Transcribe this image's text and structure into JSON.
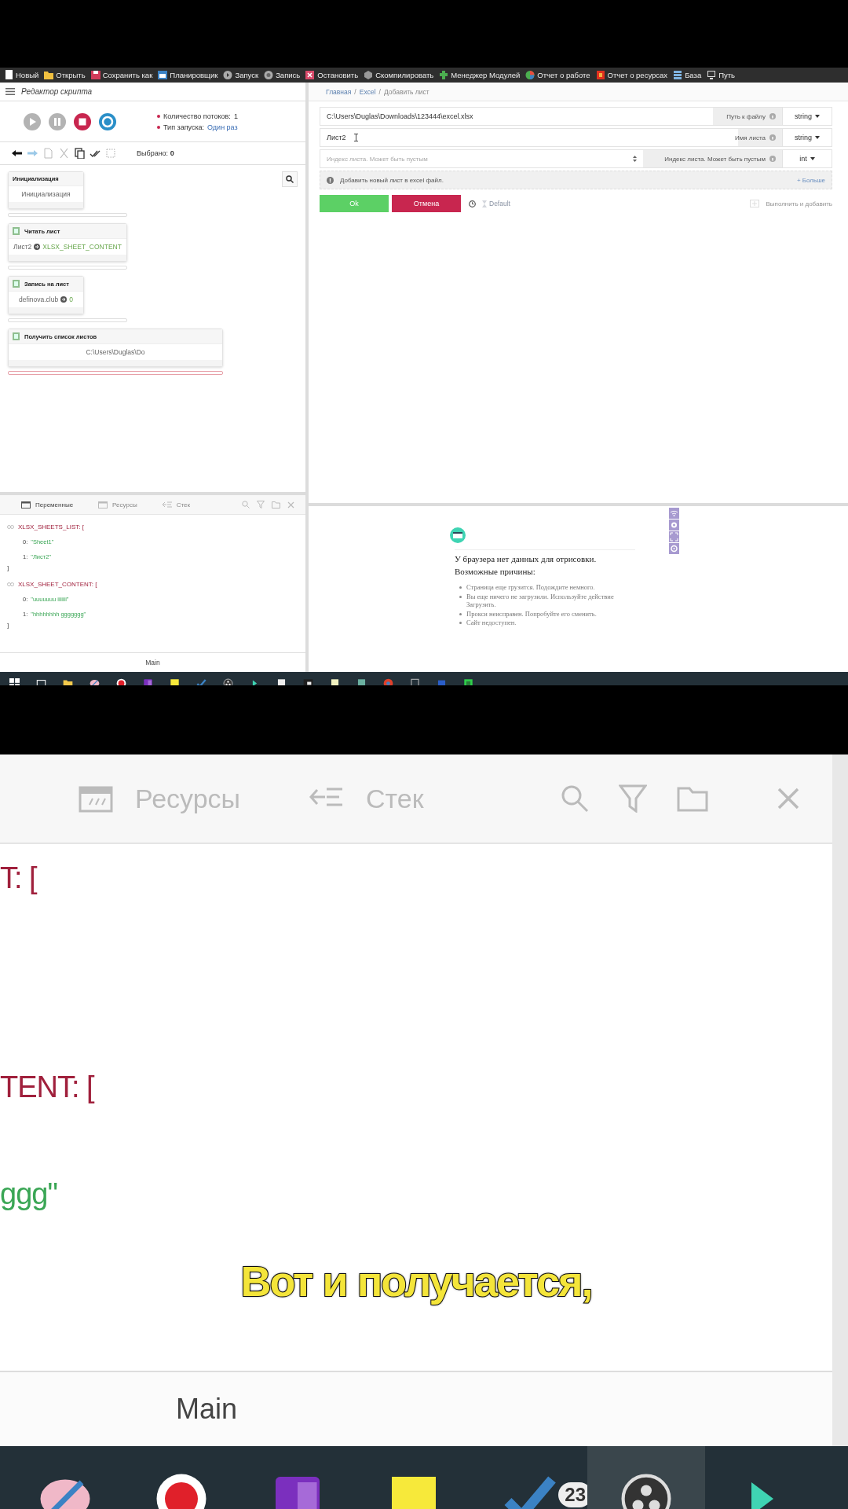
{
  "toolbar": {
    "items": [
      "Новый",
      "Открыть",
      "Сохранить как",
      "Планировщик",
      "Запуск",
      "Запись",
      "Остановить",
      "Скомпилировать",
      "Менеджер Модулей",
      "Отчет о работе",
      "Отчет о ресурсах",
      "База",
      "Путь"
    ]
  },
  "script_editor": {
    "title": "Редактор скрипта",
    "stats": [
      {
        "label": "Количество потоков:",
        "value": "1",
        "link": false
      },
      {
        "label": "Тип запуска:",
        "value": "Один раз",
        "link": true
      }
    ],
    "selected_count": {
      "label": "Выбрано:",
      "value": "0"
    },
    "nodes": [
      {
        "kind": "start",
        "title": "Инициализация",
        "input": "Инициализация"
      },
      {
        "kind": "action",
        "title": "Читать лист",
        "input": "Лист2",
        "output": "XLSX_SHEET_CONTENT"
      },
      {
        "kind": "action",
        "title": "Запись на лист",
        "input": "definova.club",
        "output": "0"
      },
      {
        "kind": "action",
        "title": "Получить список листов",
        "input": "C:\\Users\\Duglas\\Do"
      }
    ]
  },
  "variables_panel": {
    "tabs": [
      {
        "label": "Переменные",
        "selected": true
      },
      {
        "label": "Ресурсы",
        "selected": false
      },
      {
        "label": "Стек",
        "selected": false
      }
    ],
    "variables": [
      {
        "label": "XLSX_SHEETS_LIST: [",
        "items": [
          {
            "index": "0:",
            "value": "\"Sheet1\""
          },
          {
            "index": "1:",
            "value": "\"Лист2\""
          }
        ],
        "close": "]"
      },
      {
        "label": "XLSX_SHEET_CONTENT: [",
        "items": [
          {
            "index": "0:",
            "value": "\"uuuuuuu iiiiiii\""
          },
          {
            "index": "1:",
            "value": "\"hhhhhhhh ggggggg\""
          }
        ],
        "close": "]"
      }
    ],
    "footer": "Main"
  },
  "breadcrumb": {
    "items": [
      "Главная",
      "Excel",
      "Добавить лист"
    ],
    "separator": "/"
  },
  "form": {
    "fields": [
      {
        "kind": "text",
        "value": "C:\\Users\\Duglas\\Downloads\\123444\\excel.xlsx",
        "label": "Путь к файлу",
        "type": "string"
      },
      {
        "kind": "text",
        "value": "Лист2",
        "label": "Имя листа",
        "type": "string"
      },
      {
        "kind": "number",
        "placeholder": "Индекс листа. Может быть пустым",
        "label": "Индекс листа. Может быть пустым",
        "type": "int"
      }
    ],
    "info": "Добавить новый лист в excel файл.",
    "more": "+ Больше",
    "ok": "Ok",
    "cancel": "Отмена",
    "default_link": "Default",
    "run_add": "Выполнить и добавить"
  },
  "browser": {
    "title": "У браузера нет данных для отрисовки.",
    "subtitle": "Возможные причины:",
    "reasons": [
      "Страница еще грузится. Подождите немного.",
      "Вы еще ничего не загрузили. Используйте действие Загрузить.",
      "Прокси неисправен. Попробуйте его сменить.",
      "Сайт недоступен."
    ]
  },
  "zoom_view": {
    "tabs": [
      {
        "label": "Ресурсы",
        "selected": false
      },
      {
        "label": "Стек",
        "selected": false
      }
    ],
    "lines": [
      {
        "kind": "name",
        "text": "T: ["
      },
      {
        "kind": "name",
        "text": "TENT: ["
      },
      {
        "kind": "value",
        "text": "ggg\""
      }
    ],
    "footer": "Main"
  },
  "subtitle": "Вот и получается,",
  "taskbar": {
    "badge": "23"
  }
}
